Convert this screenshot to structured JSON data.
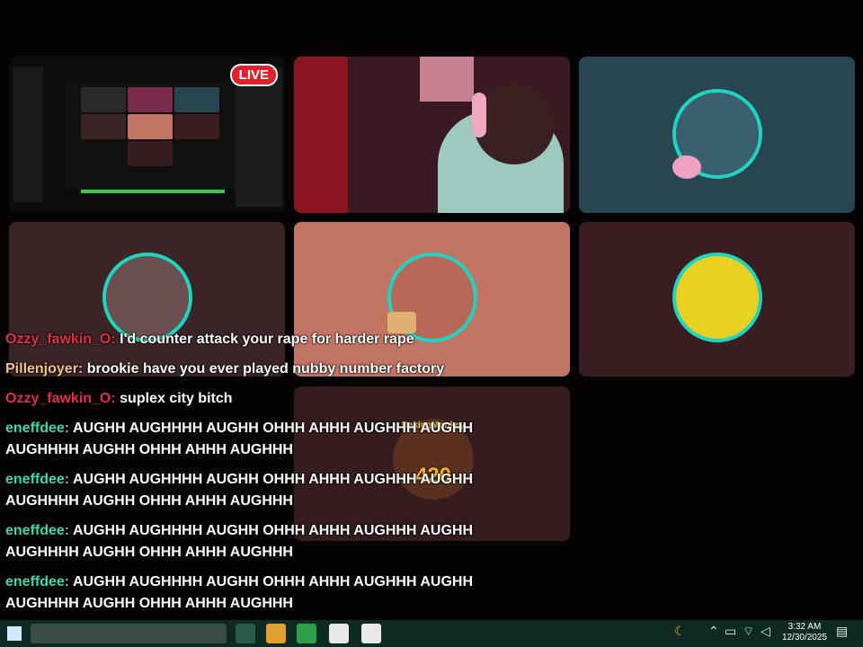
{
  "tiles": {
    "screen_share": {
      "live_label": "LIVE"
    },
    "top_center": {
      "label": ""
    },
    "top_right": {
      "label": ""
    }
  },
  "chat": {
    "messages": [
      {
        "user": "Ozzy_fawkin_O:",
        "text": "I'd counter attack your rape for harder rape",
        "color": "#e0304a"
      },
      {
        "user": "Pillenjoyer:",
        "text": "brookie have you ever played nubby number factory",
        "color": "#f3c48a"
      },
      {
        "user": "Ozzy_fawkin_O:",
        "text": "suplex city bitch",
        "color": "#e0304a"
      },
      {
        "user": "eneffdee:",
        "text": "AUGHH AUGHHHH AUGHH OHHH AHHH AUGHHH AUGHH AUGHHHH AUGHH OHHH AHHH AUGHHH",
        "color": "#3fd7b0"
      },
      {
        "user": "eneffdee:",
        "text": "AUGHH AUGHHHH AUGHH OHHH AHHH AUGHHH AUGHH AUGHHHH AUGHH OHHH AHHH AUGHHH",
        "color": "#3fd7b0"
      },
      {
        "user": "eneffdee:",
        "text": "AUGHH AUGHHHH AUGHH OHHH AHHH AUGHHH AUGHH AUGHHHH AUGHH OHHH AHHH AUGHHH",
        "color": "#3fd7b0"
      },
      {
        "user": "eneffdee:",
        "text": "AUGHH AUGHHHH AUGHH OHHH AHHH AUGHHH AUGHH AUGHHHH AUGHH OHHH AHHH AUGHHH",
        "color": "#3fd7b0"
      }
    ]
  },
  "badge": {
    "top_text": "BakingMonkey",
    "number": "420"
  },
  "taskbar": {
    "time": "3:32 AM",
    "date": "12/30/2025",
    "icons": [
      "start-icon",
      "search-icon",
      "moon-icon",
      "chevron-up-icon",
      "wifi-icon",
      "volume-icon",
      "notification-icon"
    ]
  },
  "colors": {
    "accent_teal": "#1fd4c0",
    "live_red": "#e0202a"
  }
}
